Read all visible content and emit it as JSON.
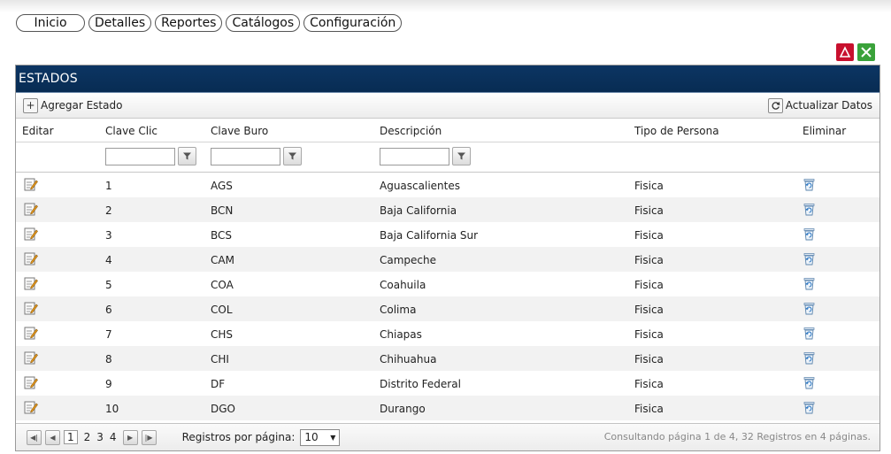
{
  "nav": {
    "tabs": [
      "Inicio",
      "Detalles",
      "Reportes",
      "Catálogos",
      "Configuración"
    ]
  },
  "exports": {
    "pdf_icon": "pdf-icon",
    "excel_icon": "excel-icon"
  },
  "grid": {
    "title": "ESTADOS",
    "toolbar": {
      "add_label": "Agregar Estado",
      "refresh_label": "Actualizar Datos"
    },
    "headers": {
      "editar": "Editar",
      "clave_clic": "Clave Clic",
      "clave_buro": "Clave Buro",
      "descripcion": "Descripción",
      "tipo_persona": "Tipo de Persona",
      "eliminar": "Eliminar"
    },
    "rows": [
      {
        "clave_clic": "1",
        "clave_buro": "AGS",
        "descripcion": "Aguascalientes",
        "tipo_persona": "Fisica"
      },
      {
        "clave_clic": "2",
        "clave_buro": "BCN",
        "descripcion": "Baja California",
        "tipo_persona": "Fisica"
      },
      {
        "clave_clic": "3",
        "clave_buro": "BCS",
        "descripcion": "Baja California Sur",
        "tipo_persona": "Fisica"
      },
      {
        "clave_clic": "4",
        "clave_buro": "CAM",
        "descripcion": "Campeche",
        "tipo_persona": "Fisica"
      },
      {
        "clave_clic": "5",
        "clave_buro": "COA",
        "descripcion": "Coahuila",
        "tipo_persona": "Fisica"
      },
      {
        "clave_clic": "6",
        "clave_buro": "COL",
        "descripcion": "Colima",
        "tipo_persona": "Fisica"
      },
      {
        "clave_clic": "7",
        "clave_buro": "CHS",
        "descripcion": "Chiapas",
        "tipo_persona": "Fisica"
      },
      {
        "clave_clic": "8",
        "clave_buro": "CHI",
        "descripcion": "Chihuahua",
        "tipo_persona": "Fisica"
      },
      {
        "clave_clic": "9",
        "clave_buro": "DF",
        "descripcion": "Distrito Federal",
        "tipo_persona": "Fisica"
      },
      {
        "clave_clic": "10",
        "clave_buro": "DGO",
        "descripcion": "Durango",
        "tipo_persona": "Fisica"
      }
    ],
    "pager": {
      "pages": [
        "1",
        "2",
        "3",
        "4"
      ],
      "current_page": "1",
      "page_size_label": "Registros por página:",
      "page_size": "10",
      "info": "Consultando página 1 de 4, 32 Registros en 4 páginas."
    }
  }
}
